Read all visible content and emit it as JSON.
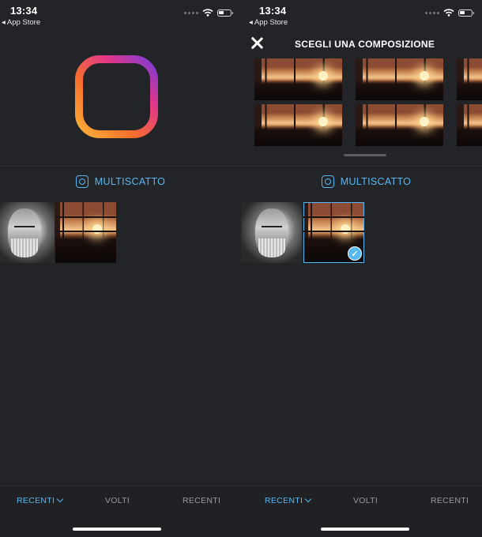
{
  "screens": [
    {
      "status": {
        "time": "13:34",
        "back_label": "◂ App Store"
      },
      "multiscatto_label": "MULTISCATTO",
      "tabs": [
        {
          "label": "RECENTI",
          "active": true
        },
        {
          "label": "VOLTI",
          "active": false
        },
        {
          "label": "RECENTI",
          "active": false
        }
      ]
    },
    {
      "status": {
        "time": "13:34",
        "back_label": "◂ App Store"
      },
      "overlay_title": "SCEGLI UNA COMPOSIZIONE",
      "multiscatto_label": "MULTISCATTO",
      "tabs": [
        {
          "label": "RECENTI",
          "active": true
        },
        {
          "label": "VOLTI",
          "active": false
        },
        {
          "label": "RECENTI",
          "active": false
        }
      ],
      "selected_photo": "sunset-photo"
    }
  ],
  "colors": {
    "accent": "#56b8f2",
    "background": "#232428",
    "logo_gradient": [
      "#7b3cd6",
      "#e0368a",
      "#f7712b",
      "#fbb03a"
    ]
  },
  "icons": [
    "layout-logo-icon",
    "multiscatto-icon",
    "close-icon",
    "chevron-down-icon",
    "checkmark-icon",
    "wifi-icon",
    "battery-icon",
    "signal-icon"
  ]
}
